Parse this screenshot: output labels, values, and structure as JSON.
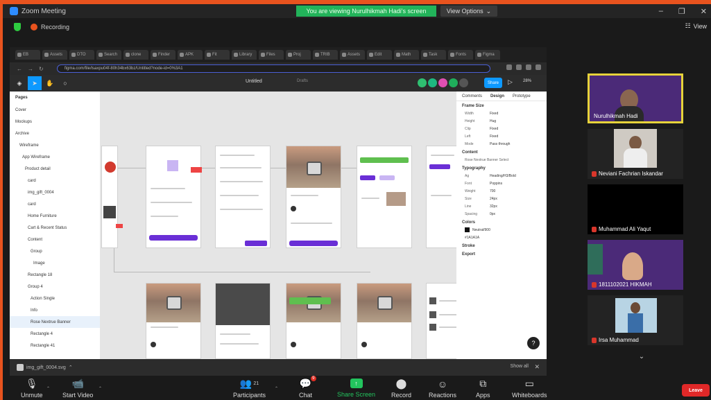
{
  "window": {
    "title": "Zoom Meeting",
    "share_banner": "You are viewing Nurulhikmah Hadi's screen",
    "view_options": "View Options",
    "minimize": "–",
    "maximize": "❐",
    "close": "✕"
  },
  "recording": {
    "label": "Recording",
    "view_button": "View"
  },
  "shared_screen": {
    "browser_tabs": [
      "EB",
      "Assets",
      "DTO",
      "Search",
      "clone",
      "Finder",
      "APK",
      "Fit",
      "Library",
      "Files",
      "Proj",
      "TRIB",
      "Assets",
      "Edit",
      "Math",
      "Task",
      "Fonts",
      "Figma"
    ],
    "url": "figma.com/file/lsaxpu04f-80h34bx63bz/Untitled?node-id=0%3A1",
    "figma": {
      "file_name": "Untitled",
      "drafts_label": "Drafts",
      "share_label": "Share",
      "zoom_level": "28%",
      "layers_header": "Pages",
      "layers": [
        "Cover",
        "Mockups",
        "Archive",
        "Wireframe",
        "App Wireframe",
        "Product detail",
        "card",
        "img_gift_0004",
        "card",
        "Home Furniture",
        "Cart & Recent Status",
        "Content",
        "Group",
        "Image",
        "Rectangle 18",
        "Group 4",
        "Action Single",
        "Info",
        "Rose Nextrue Banner",
        "Rectangle 4",
        "Rectangle 41"
      ],
      "props_tabs": [
        "Comments",
        "Design",
        "Prototype"
      ],
      "frame_section": "Frame Size",
      "frame_rows": [
        {
          "k": "Width",
          "v": "Fixed"
        },
        {
          "k": "Height",
          "v": "Hug"
        },
        {
          "k": "Clip",
          "v": "Fixed"
        },
        {
          "k": "Left",
          "v": "Fixed"
        },
        {
          "k": "Mode",
          "v": "Pass through"
        }
      ],
      "content_section": "Content",
      "content_text": "Rose Nextrue Banner Select",
      "typography_section": "Typography",
      "typography_rows": [
        {
          "k": "Ag",
          "v": "Heading/H3/Bold"
        },
        {
          "k": "Font",
          "v": "Poppins"
        },
        {
          "k": "Weight",
          "v": "700"
        },
        {
          "k": "Size",
          "v": "24px"
        },
        {
          "k": "Line",
          "v": "32px"
        },
        {
          "k": "Spacing",
          "v": "0px"
        }
      ],
      "colors_section": "Colors",
      "color_name": "Neutral/900",
      "color_hex": "#1A1A1A",
      "stroke_section": "Stroke",
      "export_section": "Export"
    },
    "taskbar_file": "img_gift_0004.svg",
    "show_all": "Show all"
  },
  "participants": [
    {
      "name": "Nurulhikmah Hadi",
      "muted": false,
      "active": true
    },
    {
      "name": "Neviani Fachrian Iskandar",
      "muted": true,
      "active": false
    },
    {
      "name": "Muhammad Ali Yaqut",
      "muted": true,
      "active": false
    },
    {
      "name": "1811102021 HIKMAH",
      "muted": true,
      "active": false
    },
    {
      "name": "Irsa Muhammad",
      "muted": true,
      "active": false
    }
  ],
  "controls": {
    "unmute": "Unmute",
    "start_video": "Start Video",
    "participants": "Participants",
    "participants_count": "21",
    "chat": "Chat",
    "chat_badge": "9",
    "share_screen": "Share Screen",
    "record": "Record",
    "reactions": "Reactions",
    "apps": "Apps",
    "whiteboards": "Whiteboards",
    "leave": "Leave"
  },
  "colors": {
    "accent_orange": "#e8531e",
    "share_green": "#22b35a",
    "figma_blue": "#0d99ff",
    "purple_button": "#6a2fd6",
    "leave_red": "#e02828",
    "active_speaker": "#e7d33a"
  }
}
